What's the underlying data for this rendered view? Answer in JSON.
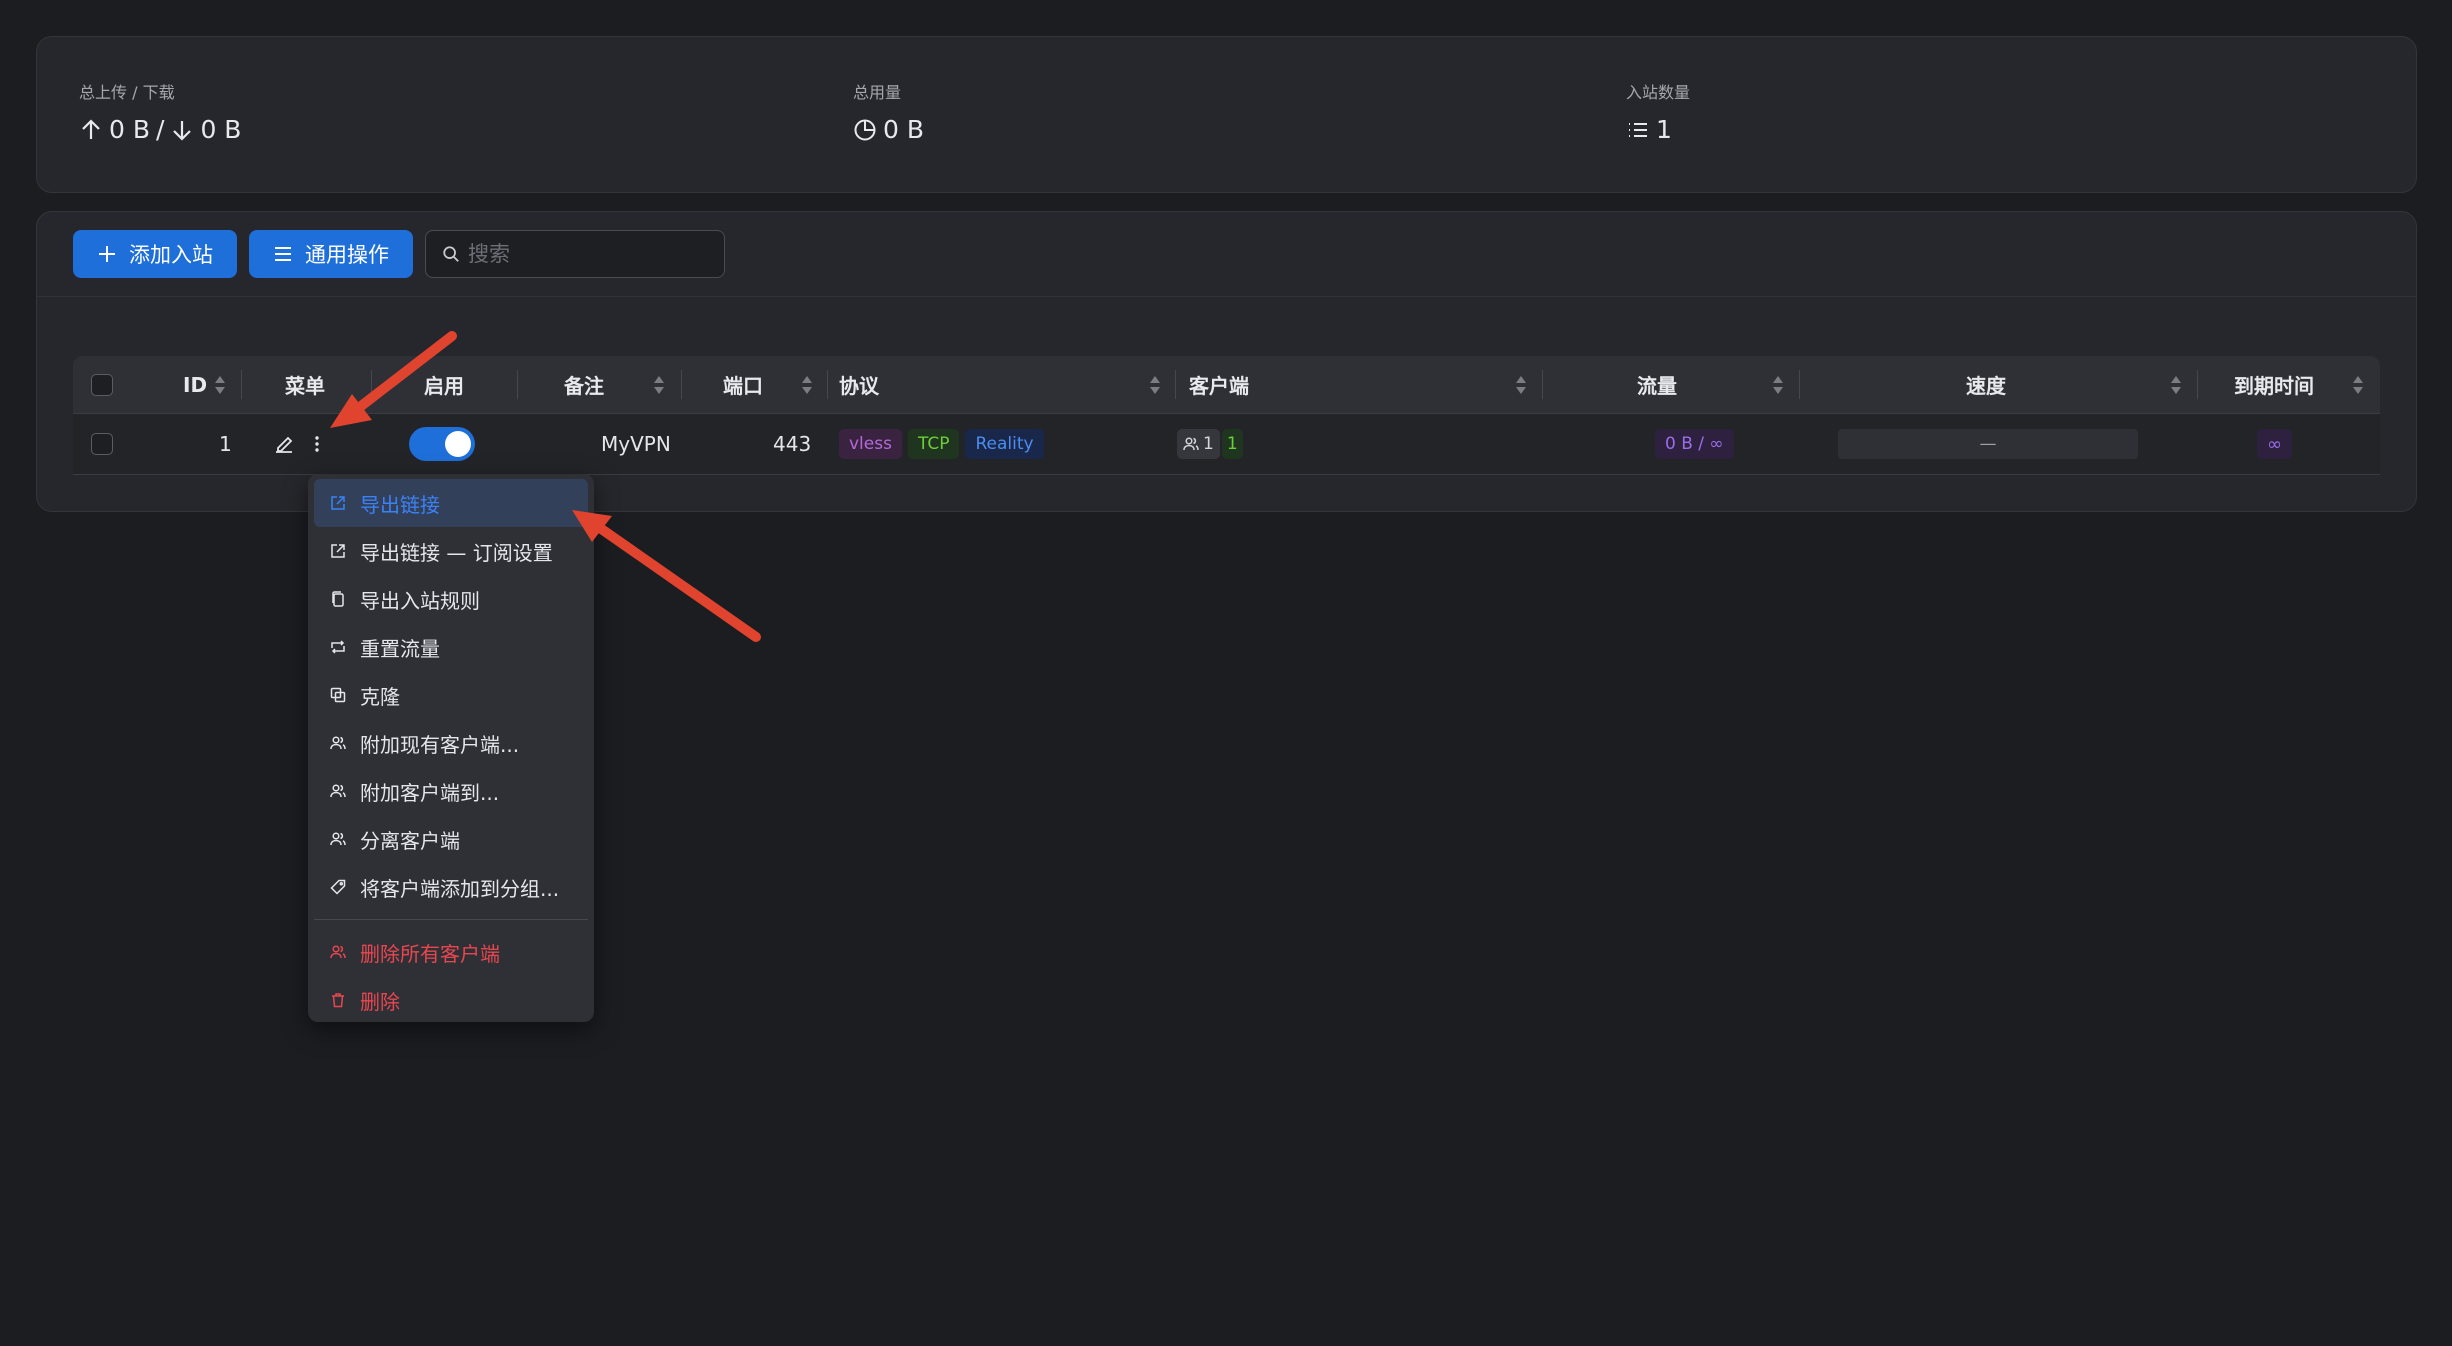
{
  "stats": {
    "traffic_label": "总上传 / 下载",
    "upload_value": "0 B",
    "separator": "/",
    "download_value": "0 B",
    "usage_label": "总用量",
    "usage_value": "0 B",
    "inbound_count_label": "入站数量",
    "inbound_count_value": "1"
  },
  "toolbar": {
    "add_label": "添加入站",
    "general_label": "通用操作",
    "search_placeholder": "搜索"
  },
  "table": {
    "headers": {
      "id": "ID",
      "menu": "菜单",
      "enable": "启用",
      "remark": "备注",
      "port": "端口",
      "protocol": "协议",
      "clients": "客户端",
      "traffic": "流量",
      "speed": "速度",
      "expiry": "到期时间"
    },
    "rows": [
      {
        "id": "1",
        "enabled": true,
        "remark": "MyVPN",
        "port": "443",
        "protocol_tags": [
          "vless",
          "TCP",
          "Reality"
        ],
        "clients_total": "1",
        "clients_online": "1",
        "traffic": "0 B / ∞",
        "speed": "—",
        "expiry": "∞"
      }
    ]
  },
  "context_menu": {
    "items": [
      {
        "label": "导出链接",
        "icon": "export-icon",
        "active": true
      },
      {
        "label": "导出链接 — 订阅设置",
        "icon": "export-icon"
      },
      {
        "label": "导出入站规则",
        "icon": "copy-icon"
      },
      {
        "label": "重置流量",
        "icon": "retweet-icon"
      },
      {
        "label": "克隆",
        "icon": "clone-icon"
      },
      {
        "label": "附加现有客户端...",
        "icon": "users-icon"
      },
      {
        "label": "附加客户端到...",
        "icon": "users-icon"
      },
      {
        "label": "分离客户端",
        "icon": "users-icon"
      },
      {
        "label": "将客户端添加到分组...",
        "icon": "tag-icon"
      },
      {
        "label": "删除所有客户端",
        "icon": "users-icon",
        "danger": true
      },
      {
        "label": "删除",
        "icon": "trash-icon",
        "danger": true
      }
    ]
  },
  "colors": {
    "accent": "#1e6fd9",
    "danger": "#e8474f",
    "annotation_arrow": "#e0432e"
  }
}
